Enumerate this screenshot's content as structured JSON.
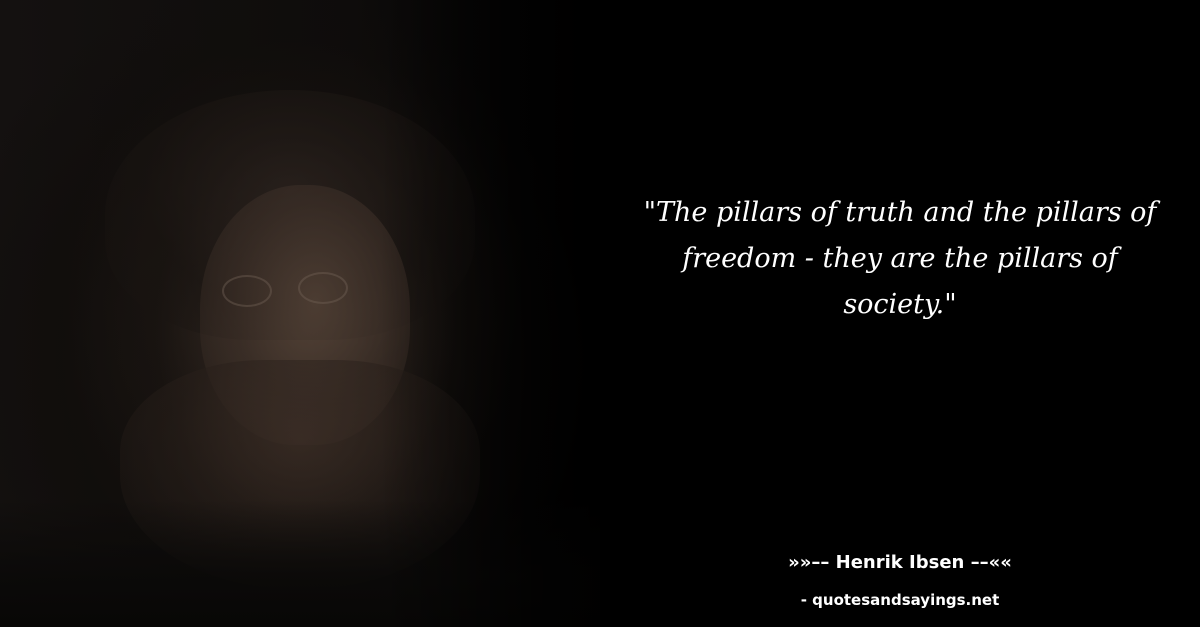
{
  "quote": {
    "text": "\"The pillars of truth and the pillars of freedom - they are the pillars of society.\""
  },
  "author": {
    "line": "»»–– Henrik Ibsen ––««"
  },
  "source": {
    "line": "- quotesandsayings.net"
  },
  "colors": {
    "background": "#000000",
    "text": "#ffffff"
  }
}
